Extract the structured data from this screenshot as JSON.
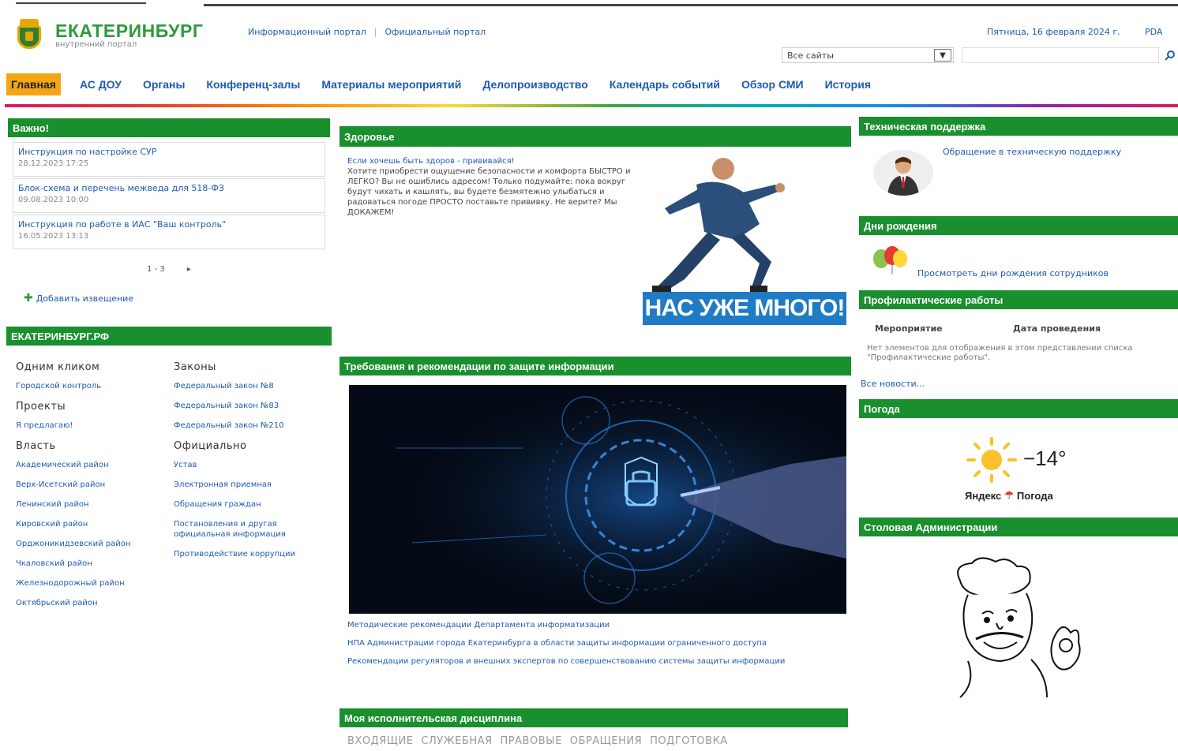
{
  "header": {
    "logo_title": "ЕКАТЕРИНБУРГ",
    "logo_subtitle": "внутренний портал",
    "link_info": "Информационный портал",
    "link_official": "Официальный портал",
    "separator": "|",
    "date": "Пятница, 16 февраля 2024 г.",
    "rss": "PDA",
    "site_select": "Все сайты",
    "search_placeholder": ""
  },
  "nav": [
    "Главная",
    "АС ДОУ",
    "Органы",
    "Конференц-залы",
    "Материалы мероприятий",
    "Делопроизводство",
    "Календарь событий",
    "Обзор СМИ",
    "История"
  ],
  "important": {
    "title": "Важно!",
    "items": [
      {
        "title": "Инструкция по настройке СУР",
        "date": "28.12.2023 17:25"
      },
      {
        "title": "Блок-схема и перечень межведа для 518-ФЗ",
        "date": "09.08.2023 10:00"
      },
      {
        "title": "Инструкция по работе в ИАС \"Ваш контроль\"",
        "date": "16.05.2023 13:13"
      }
    ],
    "pager_range": "1 - 3",
    "pager_next": "▸",
    "add_notice": "Добавить извещение"
  },
  "ekb_rf": {
    "title": "ЕКАТЕРИНБУРГ.РФ",
    "col1": [
      {
        "heading": "Одним кликом",
        "links": [
          "Городской контроль"
        ]
      },
      {
        "heading": "Проекты",
        "links": [
          "Я предлагаю!"
        ]
      },
      {
        "heading": "Власть",
        "links": [
          "Академический район",
          "Верх-Исетский район",
          "Ленинский район",
          "Кировский район",
          "Орджоникидзевский район",
          "Чкаловский район",
          "Железнодорожный район",
          "Октябрьский район"
        ]
      }
    ],
    "col2": [
      {
        "heading": "Законы",
        "links": [
          "Федеральный закон №8",
          "Федеральный закон №83",
          "Федеральный закон №210"
        ]
      },
      {
        "heading": "Официально",
        "links": [
          "Устав",
          "Электронная приемная",
          "Обращения граждан",
          "Постановления и другая официальная информация",
          "Противодействие коррупции"
        ]
      }
    ]
  },
  "health": {
    "title": "Здоровье",
    "lead": "Если хочешь быть здоров - прививайся!",
    "body": "Хотите приобрести ощущение безопасности и комфорта БЫСТРО и ЛЕГКО? Вы не ошиблись адресом! Только подумайте: пока вокруг будут чихать и кашлять, вы будете безмятежно улыбаться и радоваться погоде ПРОСТО поставьте прививку. Не верите? Мы ДОКАЖЕМ!",
    "banner": "НАС УЖЕ МНОГО!"
  },
  "security": {
    "title": "Требования и рекомендации по защите информации",
    "links": [
      "Методические рекомендации Департамента информатизации",
      "НПА Администрации города Екатеринбурга в области защиты информации ограниченного доступа",
      "Рекомендации регуляторов и внешних экспертов по совершенствованию системы защиты информации"
    ]
  },
  "discipline": {
    "title": "Моя исполнительская дисциплина",
    "tabs": [
      "ВХОДЯЩИЕ",
      "СЛУЖЕБНАЯ",
      "ПРАВОВЫЕ",
      "ОБРАЩЕНИЯ",
      "ПОДГОТОВКА"
    ]
  },
  "support": {
    "title": "Техническая поддержка",
    "link": "Обращение в техническую поддержку"
  },
  "birthdays": {
    "title": "Дни рождения",
    "link": "Просмотреть дни рождения сотрудников"
  },
  "maintenance": {
    "title": "Профилактические работы",
    "col_event": "Мероприятие",
    "col_date": "Дата проведения",
    "empty": "Нет элементов для отображения в этом представлении списка \"Профилактические работы\".",
    "all_news": "Все новости..."
  },
  "weather": {
    "title": "Погода",
    "temp": "−14°",
    "source_a": "Яндекс",
    "source_b": "Погода"
  },
  "canteen": {
    "title": "Столовая Администрации"
  },
  "colors": {
    "green": "#1a8f2e",
    "link": "#1f5bb0",
    "active_tab": "#f3a515"
  }
}
